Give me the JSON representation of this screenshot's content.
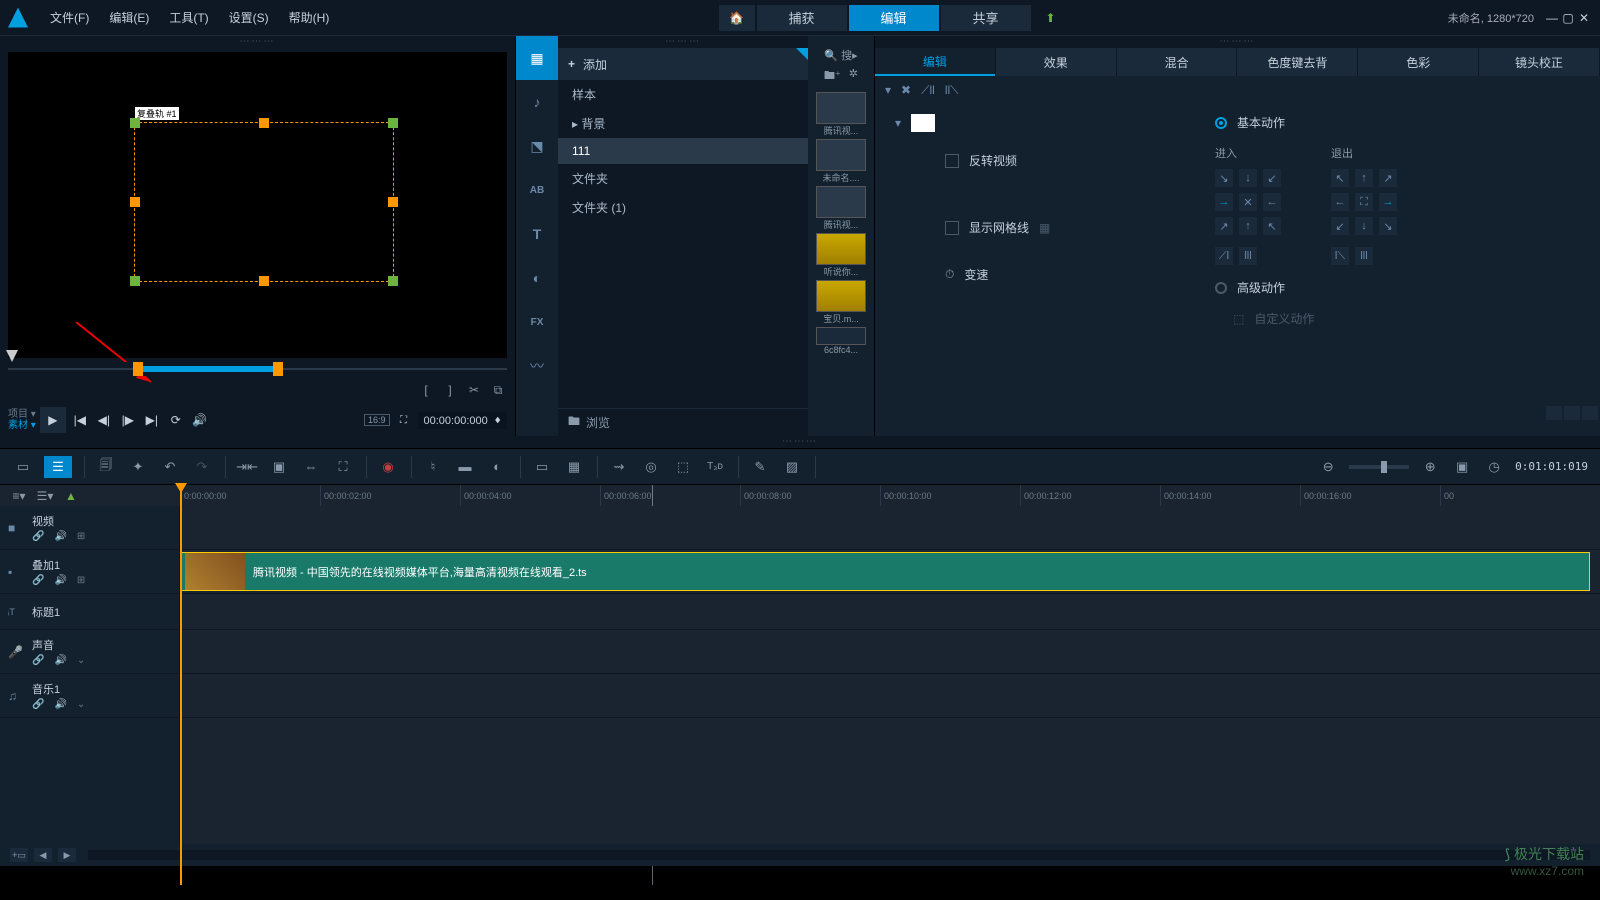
{
  "menu": {
    "file": "文件(F)",
    "edit": "编辑(E)",
    "tools": "工具(T)",
    "settings": "设置(S)",
    "help": "帮助(H)"
  },
  "topTabs": {
    "capture": "捕获",
    "edit": "编辑",
    "share": "共享"
  },
  "windowTitle": "未命名, 1280*720",
  "preview": {
    "selectionLabel": "复叠轨 #1",
    "modeProject": "项目 ▾",
    "modeClip": "素材 ▾",
    "timecode": "00:00:00:000",
    "aspect": "16:9"
  },
  "library": {
    "add": "添加",
    "browse": "浏览",
    "tree": [
      "样本",
      "背景",
      "111",
      "文件夹",
      "文件夹 (1)"
    ],
    "selectedIndex": 2,
    "search": "搜",
    "thumbs": [
      {
        "label": "腾讯视..."
      },
      {
        "label": "未命名...."
      },
      {
        "label": "腾讯视..."
      },
      {
        "label": "听说你..."
      },
      {
        "label": "宝贝.m..."
      },
      {
        "label": "6c8fc4..."
      }
    ]
  },
  "props": {
    "tabs": [
      "编辑",
      "效果",
      "混合",
      "色度键去背",
      "色彩",
      "镜头校正"
    ],
    "reverse": "反转视频",
    "grid": "显示网格线",
    "speed": "变速",
    "basicMotion": "基本动作",
    "enter": "进入",
    "exit": "退出",
    "advMotion": "高级动作",
    "customMotion": "自定义动作"
  },
  "ruler": {
    "ticks": [
      "0:00:00:00",
      "00:00:02:00",
      "00:00:04:00",
      "00:00:06:00",
      "00:00:08:00",
      "00:00:10:00",
      "00:00:12:00",
      "00:00:14:00",
      "00:00:16:00",
      "00"
    ]
  },
  "toolbar": {
    "timecode": "0:01:01:019"
  },
  "tracks": [
    {
      "icon": "video",
      "name": "视频",
      "controls": [
        "link",
        "vol",
        "fx"
      ]
    },
    {
      "icon": "overlay",
      "name": "叠加1",
      "controls": [
        "link",
        "vol",
        "fx"
      ]
    },
    {
      "icon": "title",
      "name": "标题1",
      "controls": []
    },
    {
      "icon": "voice",
      "name": "声音",
      "controls": [
        "link",
        "vol",
        "exp"
      ]
    },
    {
      "icon": "music",
      "name": "音乐1",
      "controls": [
        "link",
        "vol",
        "exp"
      ]
    }
  ],
  "clip": {
    "text": "腾讯视频 - 中国领先的在线视频媒体平台,海量高清视频在线观看_2.ts"
  },
  "watermark": {
    "name": "极光下载站",
    "url": "www.xz7.com"
  }
}
